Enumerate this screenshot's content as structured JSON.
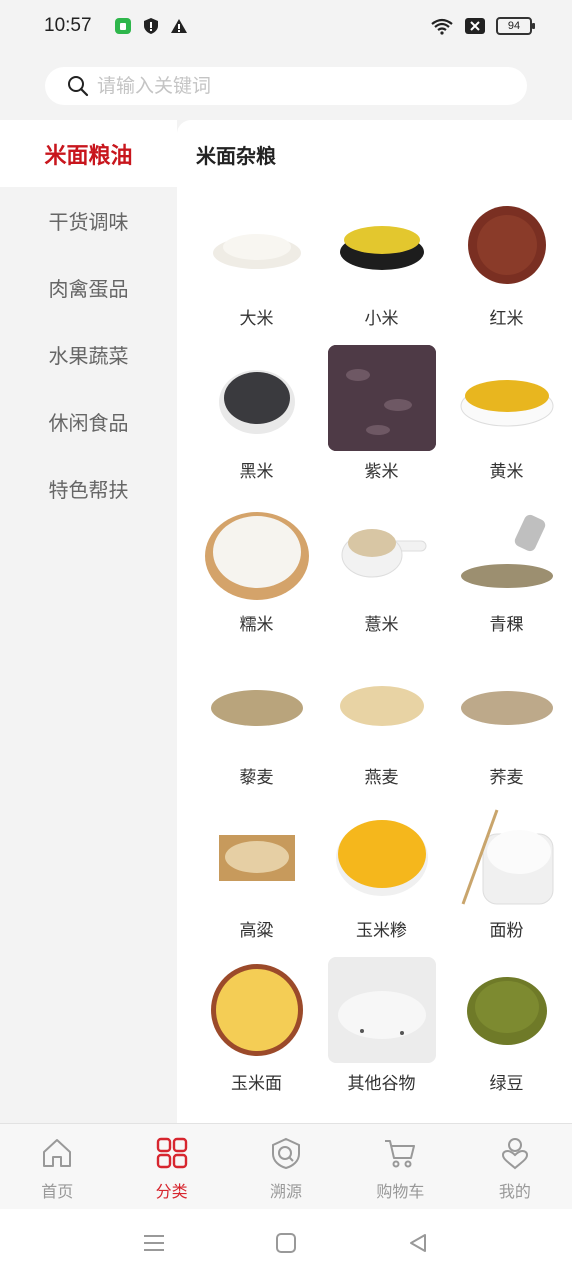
{
  "status_bar": {
    "time": "10:57",
    "battery": "94",
    "icons": [
      "app-icon",
      "shield-icon",
      "warning-icon",
      "wifi-icon",
      "sim-off-icon",
      "battery-icon"
    ]
  },
  "search": {
    "placeholder": "请输入关键词"
  },
  "sidebar": {
    "items": [
      {
        "label": "米面粮油",
        "active": true
      },
      {
        "label": "干货调味"
      },
      {
        "label": "肉禽蛋品"
      },
      {
        "label": "水果蔬菜"
      },
      {
        "label": "休闲食品"
      },
      {
        "label": "特色帮扶"
      }
    ]
  },
  "content": {
    "title": "米面杂粮",
    "products": [
      {
        "name": "大米"
      },
      {
        "name": "小米"
      },
      {
        "name": "红米"
      },
      {
        "name": "黑米"
      },
      {
        "name": "紫米"
      },
      {
        "name": "黄米"
      },
      {
        "name": "糯米"
      },
      {
        "name": "薏米"
      },
      {
        "name": "青稞"
      },
      {
        "name": "藜麦"
      },
      {
        "name": "燕麦"
      },
      {
        "name": "荞麦"
      },
      {
        "name": "高粱"
      },
      {
        "name": "玉米糁"
      },
      {
        "name": "面粉"
      },
      {
        "name": "玉米面"
      },
      {
        "name": "其他谷物"
      },
      {
        "name": "绿豆"
      }
    ]
  },
  "tabbar": {
    "items": [
      {
        "label": "首页",
        "icon": "home-icon"
      },
      {
        "label": "分类",
        "icon": "category-icon",
        "active": true
      },
      {
        "label": "溯源",
        "icon": "trace-icon"
      },
      {
        "label": "购物车",
        "icon": "cart-icon"
      },
      {
        "label": "我的",
        "icon": "profile-icon"
      }
    ]
  },
  "colors": {
    "accent": "#c8161d",
    "tab_active": "#d7262f"
  }
}
